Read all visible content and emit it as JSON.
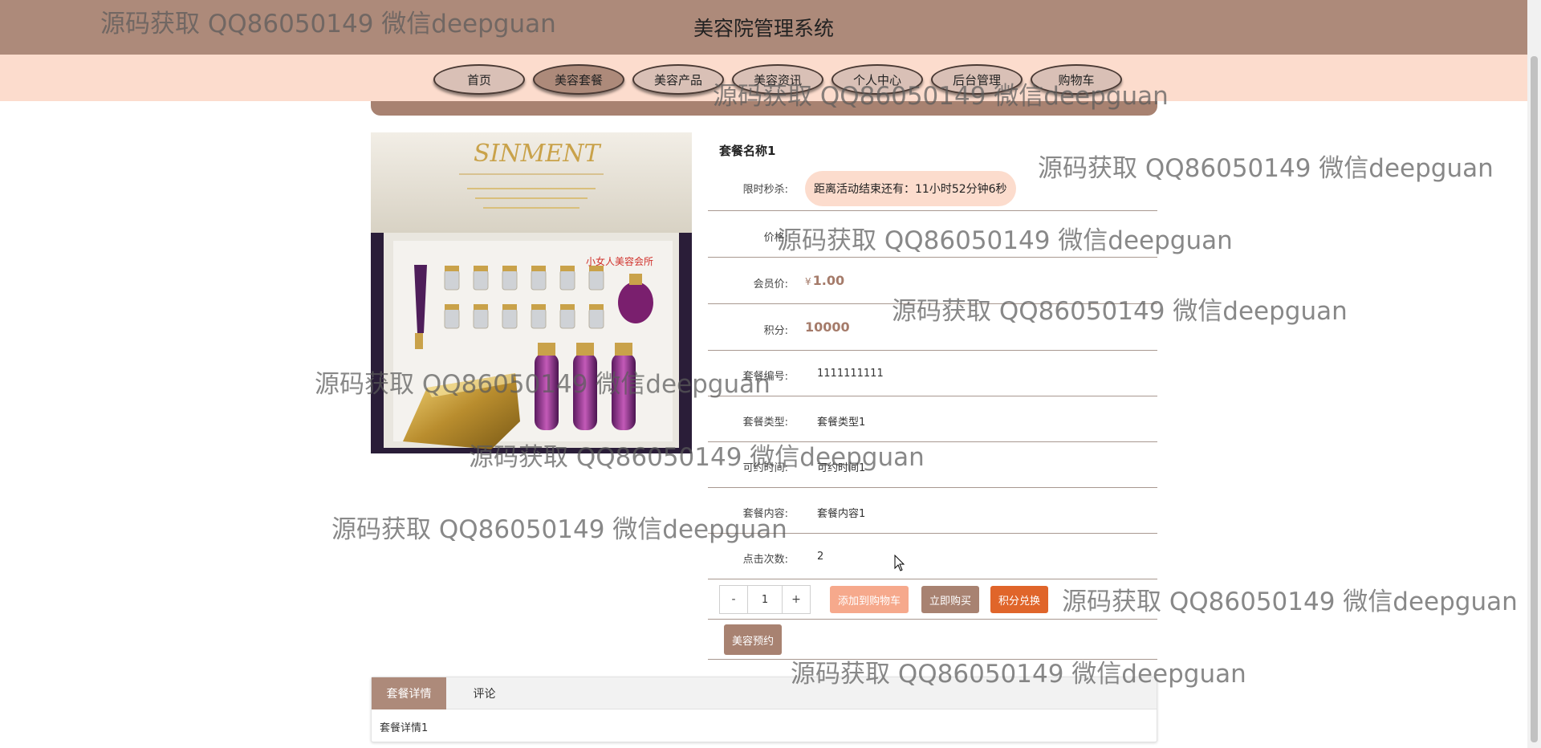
{
  "site_title": "美容院管理系统",
  "nav": [
    "首页",
    "美容套餐",
    "美容产品",
    "美容资讯",
    "个人中心",
    "后台管理",
    "购物车"
  ],
  "nav_active": "美容套餐",
  "product": {
    "name": "套餐名称1",
    "image_overlay_text": "小女人美容会所",
    "rows": {
      "flash_label": "限时秒杀:",
      "countdown": "距离活动结束还有：11小时52分钟6秒",
      "price_label": "价格:",
      "member_price_label": "会员价:",
      "member_price_currency": "¥",
      "member_price": "1.00",
      "points_label": "积分:",
      "points": "10000",
      "code_label": "套餐编号:",
      "code": "1111111111",
      "type_label": "套餐类型:",
      "type": "套餐类型1",
      "time_label": "可约时间:",
      "time": "可约时间1",
      "content_label": "套餐内容:",
      "content": "套餐内容1",
      "clicks_label": "点击次数:",
      "clicks": "2"
    },
    "quantity": {
      "minus": "-",
      "value": "1",
      "plus": "+"
    },
    "buttons": {
      "add_to_cart": "添加到购物车",
      "buy_now": "立即购买",
      "points_exchange": "积分兑换",
      "book": "美容预约"
    }
  },
  "tabs": {
    "items": [
      "套餐详情",
      "评论"
    ],
    "active": "套餐详情",
    "content": "套餐详情1"
  },
  "watermark": "源码获取 QQ86050149 微信deepguan",
  "colors": {
    "header": "#ad8a7a",
    "nav_bar": "#fcdccd",
    "accent": "#ad8a7a",
    "add_to_cart": "#f6a98c",
    "buy_now": "#a88271",
    "points_exchange": "#e0652a"
  }
}
